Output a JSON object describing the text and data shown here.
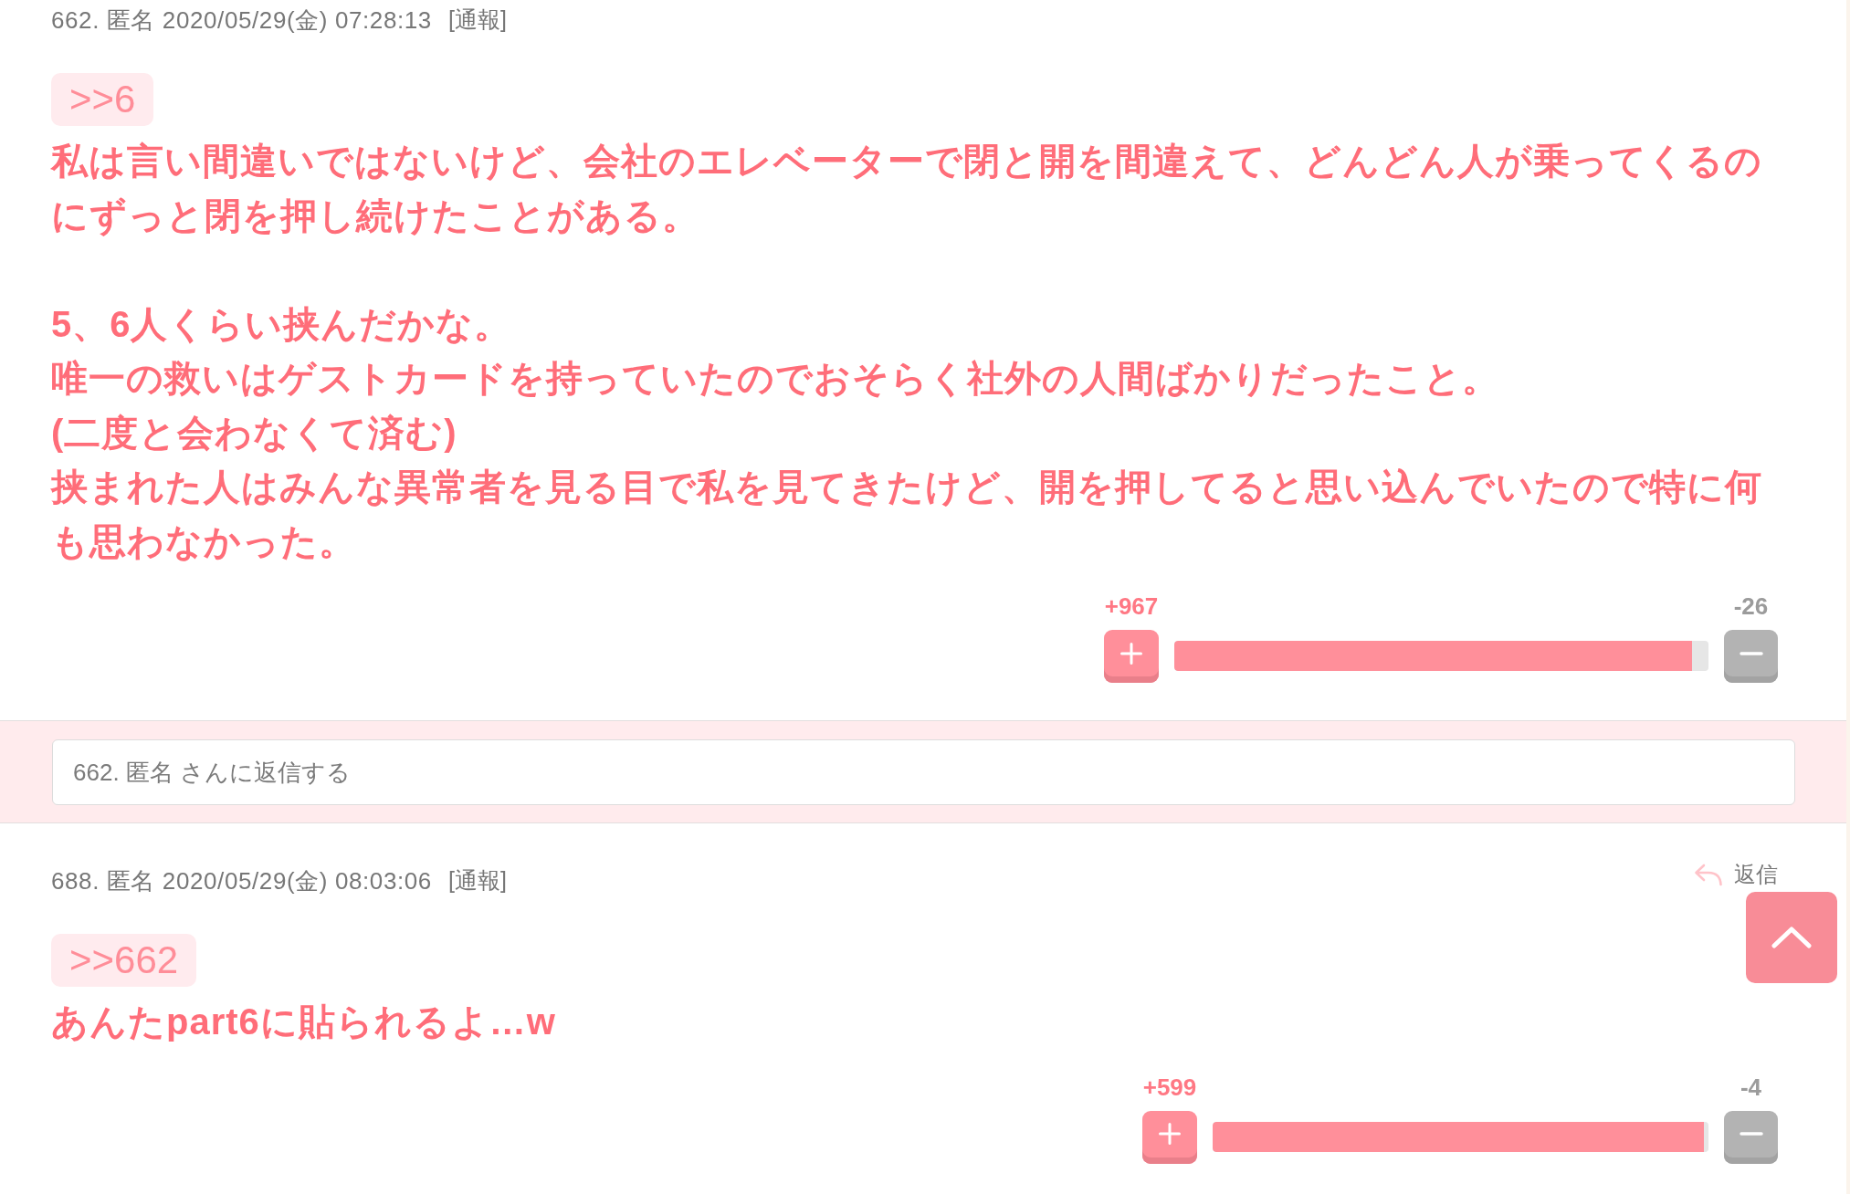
{
  "posts": [
    {
      "meta": "662. 匿名 2020/05/29(金) 07:28:13",
      "report_link": "[通報]",
      "anchor": ">>6",
      "paragraphs": [
        [
          "私は言い間違いではないけど、会社のエレベーターで閉と開を間違えて、どんどん人が乗ってくるのにずっと閉を押し続けたことがある。"
        ],
        [
          "5、6人くらい挟んだかな。",
          "唯一の救いはゲストカードを持っていたのでおそらく社外の人間ばかりだったこと。",
          "(二度と会わなくて済む)",
          "挟まれた人はみんな異常者を見る目で私を見てきたけど、開を押してると思い込んでいたので特に何も思わなかった。"
        ]
      ],
      "votes": {
        "up": "+967",
        "down": "-26",
        "level": 0.97
      },
      "reply_form": {
        "placeholder": "662. 匿名 さんに返信する"
      }
    },
    {
      "meta": "688. 匿名 2020/05/29(金) 08:03:06",
      "report_link": "[通報]",
      "reply_link": "返信",
      "anchor": ">>662",
      "paragraphs": [
        [
          "あんたpart6に貼られるよ…w"
        ]
      ],
      "votes": {
        "up": "+599",
        "down": "-4",
        "level": 0.99
      }
    }
  ]
}
